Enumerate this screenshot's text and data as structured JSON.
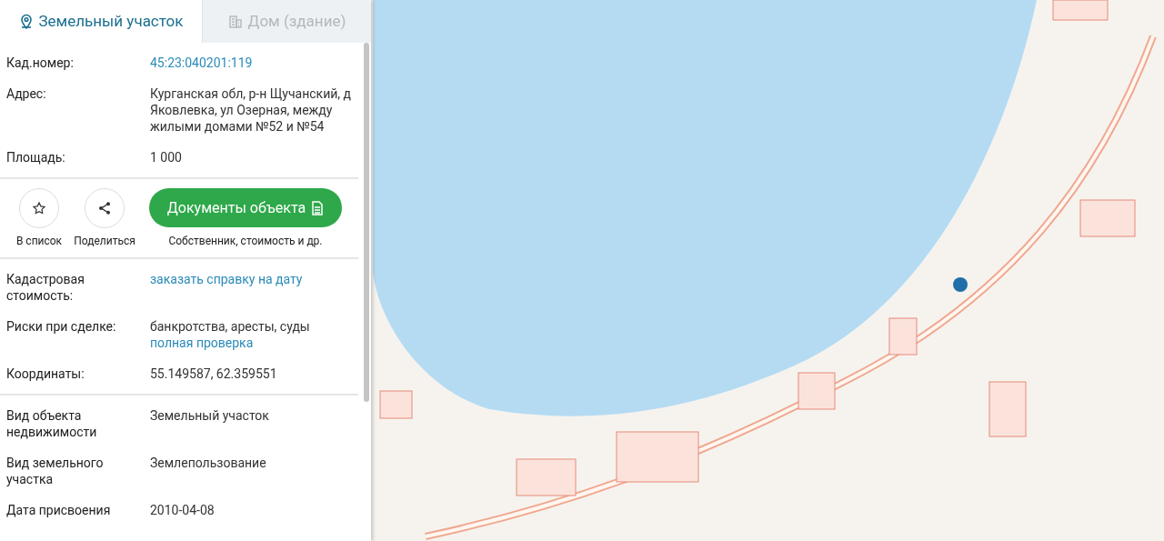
{
  "tabs": [
    {
      "label": "Земельный участок",
      "kind": "pin",
      "selected": true
    },
    {
      "label": "Дом (здание)",
      "kind": "building",
      "selected": false
    }
  ],
  "sections": [
    {
      "rows": [
        {
          "label": "Кад.номер:",
          "values": [
            {
              "kind": "link",
              "text": "45:23:040201:119"
            }
          ]
        },
        {
          "label": "Адрес:",
          "values": [
            {
              "kind": "text",
              "text": "Курганская обл, р-н Щучанский, д Яковлевка, ул Озерная, между жилыми домами №52 и №54"
            }
          ]
        },
        {
          "label": "Площадь:",
          "values": [
            {
              "kind": "text",
              "text": "1 000"
            }
          ]
        }
      ]
    },
    {
      "actions": [
        {
          "label": "В список",
          "kind": "star"
        },
        {
          "label": "Поделиться",
          "kind": "share"
        }
      ],
      "documents": {
        "label": "Документы объекта",
        "caption": "Собственник, стоимость и др."
      }
    },
    {
      "rows": [
        {
          "label": "Кадастровая стоимость:",
          "values": [
            {
              "kind": "link",
              "text": "заказать справку на дату"
            }
          ]
        },
        {
          "label": "Риски при сделке:",
          "values": [
            {
              "kind": "text",
              "text": "банкротства, аресты, суды"
            },
            {
              "kind": "link",
              "text": "полная проверка"
            }
          ]
        },
        {
          "label": "Координаты:",
          "values": [
            {
              "kind": "text",
              "text": "55.149587, 62.359551"
            }
          ]
        }
      ]
    },
    {
      "rows": [
        {
          "label": "Вид объекта недвижимости",
          "values": [
            {
              "kind": "text",
              "text": "Земельный участок"
            }
          ]
        },
        {
          "label": "Вид земельного участка",
          "values": [
            {
              "kind": "text",
              "text": "Землепользование"
            }
          ]
        },
        {
          "label": "Дата присвоения",
          "values": [
            {
              "kind": "text",
              "text": "2010-04-08"
            }
          ]
        }
      ]
    }
  ]
}
